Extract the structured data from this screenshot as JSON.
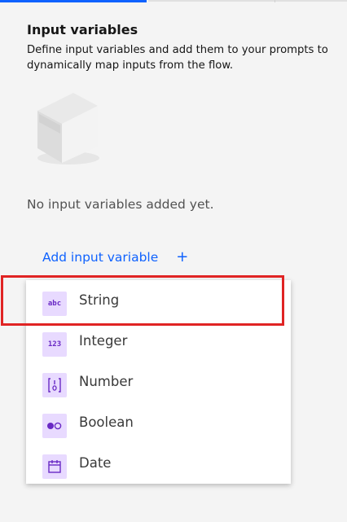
{
  "panel": {
    "title": "Input variables",
    "description": "Define input variables and add them to your prompts to dynamically map inputs from the flow.",
    "empty_state": "No input variables added yet.",
    "add_button_label": "Add input variable",
    "add_button_icon": "plus-icon",
    "illustration_icon": "box-icon"
  },
  "dropdown": {
    "items": [
      {
        "label": "String",
        "icon": "string-icon",
        "icon_text": "abc"
      },
      {
        "label": "Integer",
        "icon": "integer-icon",
        "icon_text": "123"
      },
      {
        "label": "Number",
        "icon": "number-icon"
      },
      {
        "label": "Boolean",
        "icon": "boolean-icon"
      },
      {
        "label": "Date",
        "icon": "calendar-icon"
      }
    ]
  },
  "colors": {
    "accent": "#0f62fe",
    "icon_background": "#e8daff",
    "icon_foreground": "#6929c4",
    "highlight_border": "#e02424"
  }
}
